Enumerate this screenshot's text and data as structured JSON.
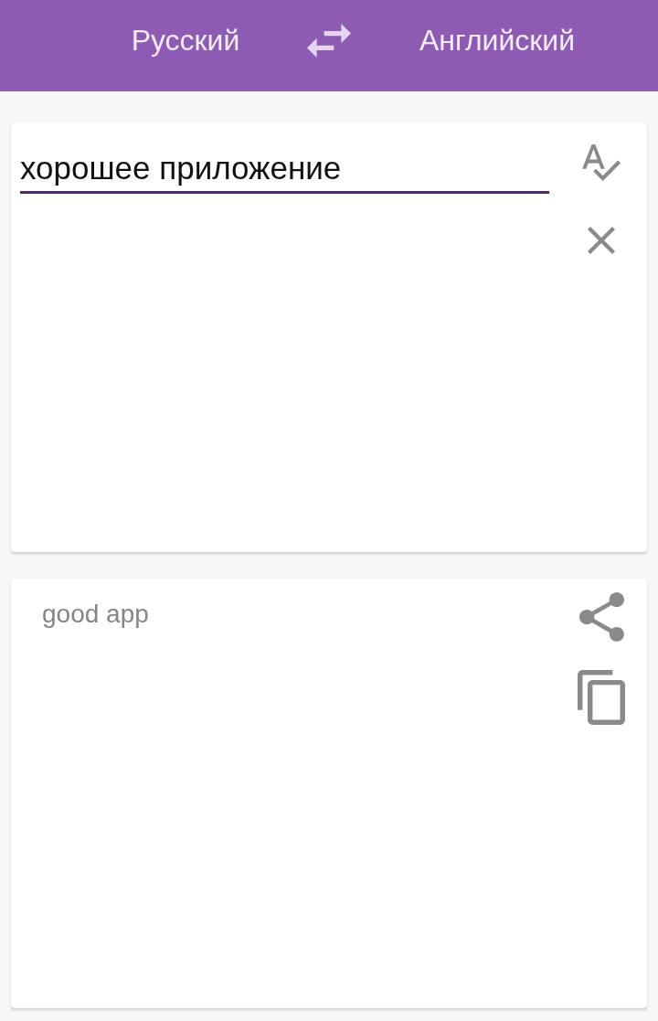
{
  "toolbar": {
    "source_language": "Русский",
    "target_language": "Английский"
  },
  "input_card": {
    "value": "хорошее приложение"
  },
  "output_card": {
    "translation": "good app"
  }
}
